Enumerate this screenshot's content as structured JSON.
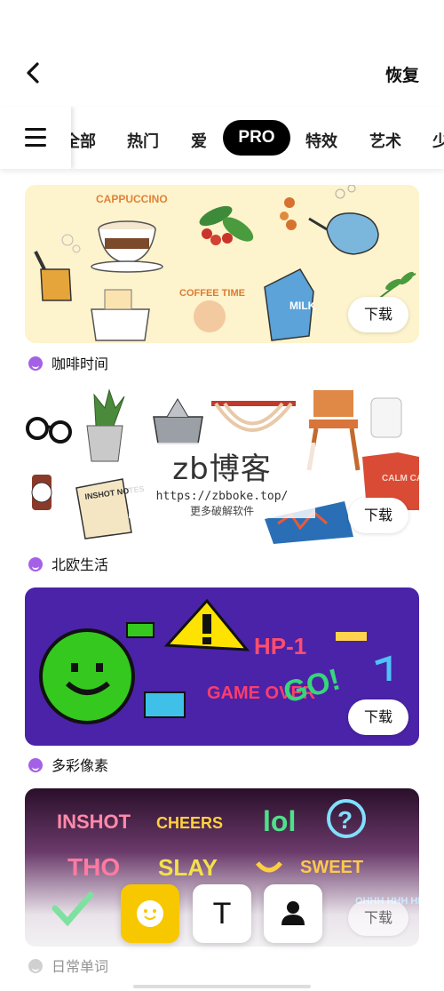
{
  "header": {
    "restore_label": "恢复"
  },
  "tabs": [
    "全部",
    "热门",
    "爱",
    "PRO",
    "特效",
    "艺术",
    "少"
  ],
  "active_tab": "PRO",
  "packs": [
    {
      "name": "咖啡时间",
      "download_label": "下载",
      "card_text": [
        "CAPPUCCINO",
        "COFFEE TIME",
        "MILK"
      ]
    },
    {
      "name": "北欧生活",
      "download_label": "下载",
      "card_text": [
        "INSHOT NOTES",
        "CALM CALM CALM"
      ]
    },
    {
      "name": "多彩像素",
      "download_label": "下载",
      "card_text": [
        "HP-1",
        "GAME OVER",
        "GO!"
      ]
    },
    {
      "name": "日常单词",
      "download_label": "下载",
      "card_text": [
        "INSHOT",
        "CHEERS",
        "lol",
        "?",
        "THO",
        "SLAY",
        "SWEET",
        "OHHH HHH HHH"
      ]
    }
  ],
  "watermark": {
    "title": "zb博客",
    "url": "https://zbboke.top/",
    "subtitle": "更多破解软件"
  },
  "bottom_actions": {
    "text_label": "T"
  },
  "colors": {
    "coffee_bg": "#fdf3cc",
    "pixel_bg": "#4a23a8",
    "word_bg_top": "#2a0f2a",
    "accent_yellow": "#f7c700",
    "icon_purple": "#a560e8"
  }
}
